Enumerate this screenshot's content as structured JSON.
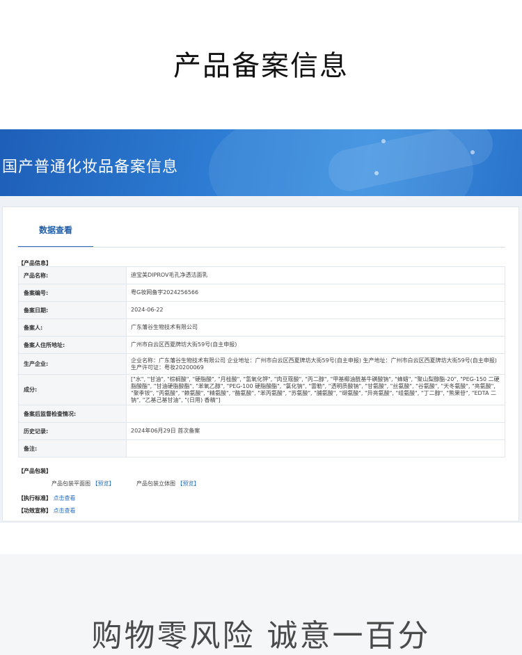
{
  "page_title": "产品备案信息",
  "banner_title": "国产普通化妆品备案信息",
  "tab_label": "数据查看",
  "product_info": {
    "section_label": "【产品信息】",
    "rows": [
      {
        "key": "产品名称:",
        "value": "迪宝美DIPROV毛孔净透洁面乳"
      },
      {
        "key": "备案编号:",
        "value": "粤G妆网备字2024256566"
      },
      {
        "key": "备案日期:",
        "value": "2024-06-22"
      },
      {
        "key": "备案人:",
        "value": "广东藩谷生物技术有限公司"
      },
      {
        "key": "备案人住所地址:",
        "value": "广州市白云区西夏牌坊大街59号(自主申报)"
      },
      {
        "key": "生产企业:",
        "value": "企业名称：广东藩谷生物技术有限公司 企业地址：广州市白云区西夏牌坊大街59号(自主申报) 生产地址：广州市白云区西夏牌坊大街59号(自主申报) 生产许可证：粤妆20200069"
      },
      {
        "key": "成分:",
        "value": "[\"水\", \"甘油\", \"棕榈酸\", \"硬脂酸\", \"月桂酸\", \"氢氧化钾\", \"肉豆蔻酸\", \"丙二醇\", \"甲基椰油酰基牛磺酸钠\", \"蜂蜡\", \"聚山梨醇酯-20\", \"PEG-150 二硬脂酸酯\", \"甘油硬脂酸酯\", \"苯氧乙醇\", \"PEG-100 硬脂酸酯\", \"氯化钠\", \"雷勒\", \"透明质酸钠\", \"甘氨酸\", \"丝氨酸\", \"谷氨酸\", \"天冬氨酸\", \"亮氨酸\", \"聚季铵\", \"丙氨酸\", \"赖氨酸\", \"精氨酸\", \"酪氨酸\", \"苯丙氨酸\", \"苏氨酸\", \"脯氨酸\", \"缬氨酸\", \"异亮氨酸\", \"组氨酸\", \"丁二醇\", \"熊果苷\", \"EDTA 二钠\", \"乙基己基甘油\", \"(日用) 香精\"]"
      },
      {
        "key": "备案后监督检查情况:",
        "value": ""
      },
      {
        "key": "历史记录:",
        "value": "2024年06月29日 首次备案"
      },
      {
        "key": "备注:",
        "value": ""
      }
    ]
  },
  "packaging": {
    "section_label": "【产品包装】",
    "flat_label": "产品包装平面图",
    "flat_link": "【预览】",
    "solid_label": "产品包装立体图",
    "solid_link": "【预览】"
  },
  "standard": {
    "label": "【执行标准】",
    "link": "点击查看"
  },
  "efficacy": {
    "label": "【功效宣称】",
    "link": "点击查看"
  },
  "slogan": "购物零风险 诚意一百分"
}
